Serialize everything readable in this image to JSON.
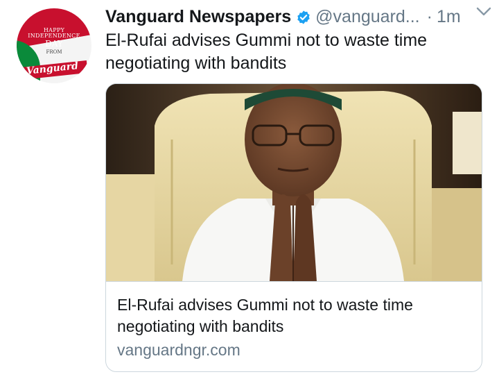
{
  "tweet": {
    "account_name": "Vanguard Newspapers",
    "handle": "@vanguard...",
    "separator": "·",
    "time": "1m",
    "text_line1": "El-Rufai advises Gummi not to waste time",
    "text_line2": "negotiating with bandits"
  },
  "avatar": {
    "line1": "HAPPY",
    "line2": "INDEPENDENCE",
    "line3": "DAY",
    "line4": "FROM",
    "brand": "Vanguard"
  },
  "card": {
    "title_line1": "El-Rufai advises Gummi not to waste time",
    "title_line2": "negotiating with bandits",
    "domain": "vanguardngr.com"
  },
  "icons": {
    "verified": "verified-badge-icon",
    "more": "chevron-down-icon"
  },
  "colors": {
    "verified_blue": "#1da1f2",
    "text_primary": "#14171a",
    "text_secondary": "#657786",
    "border": "#ccd6dd"
  }
}
